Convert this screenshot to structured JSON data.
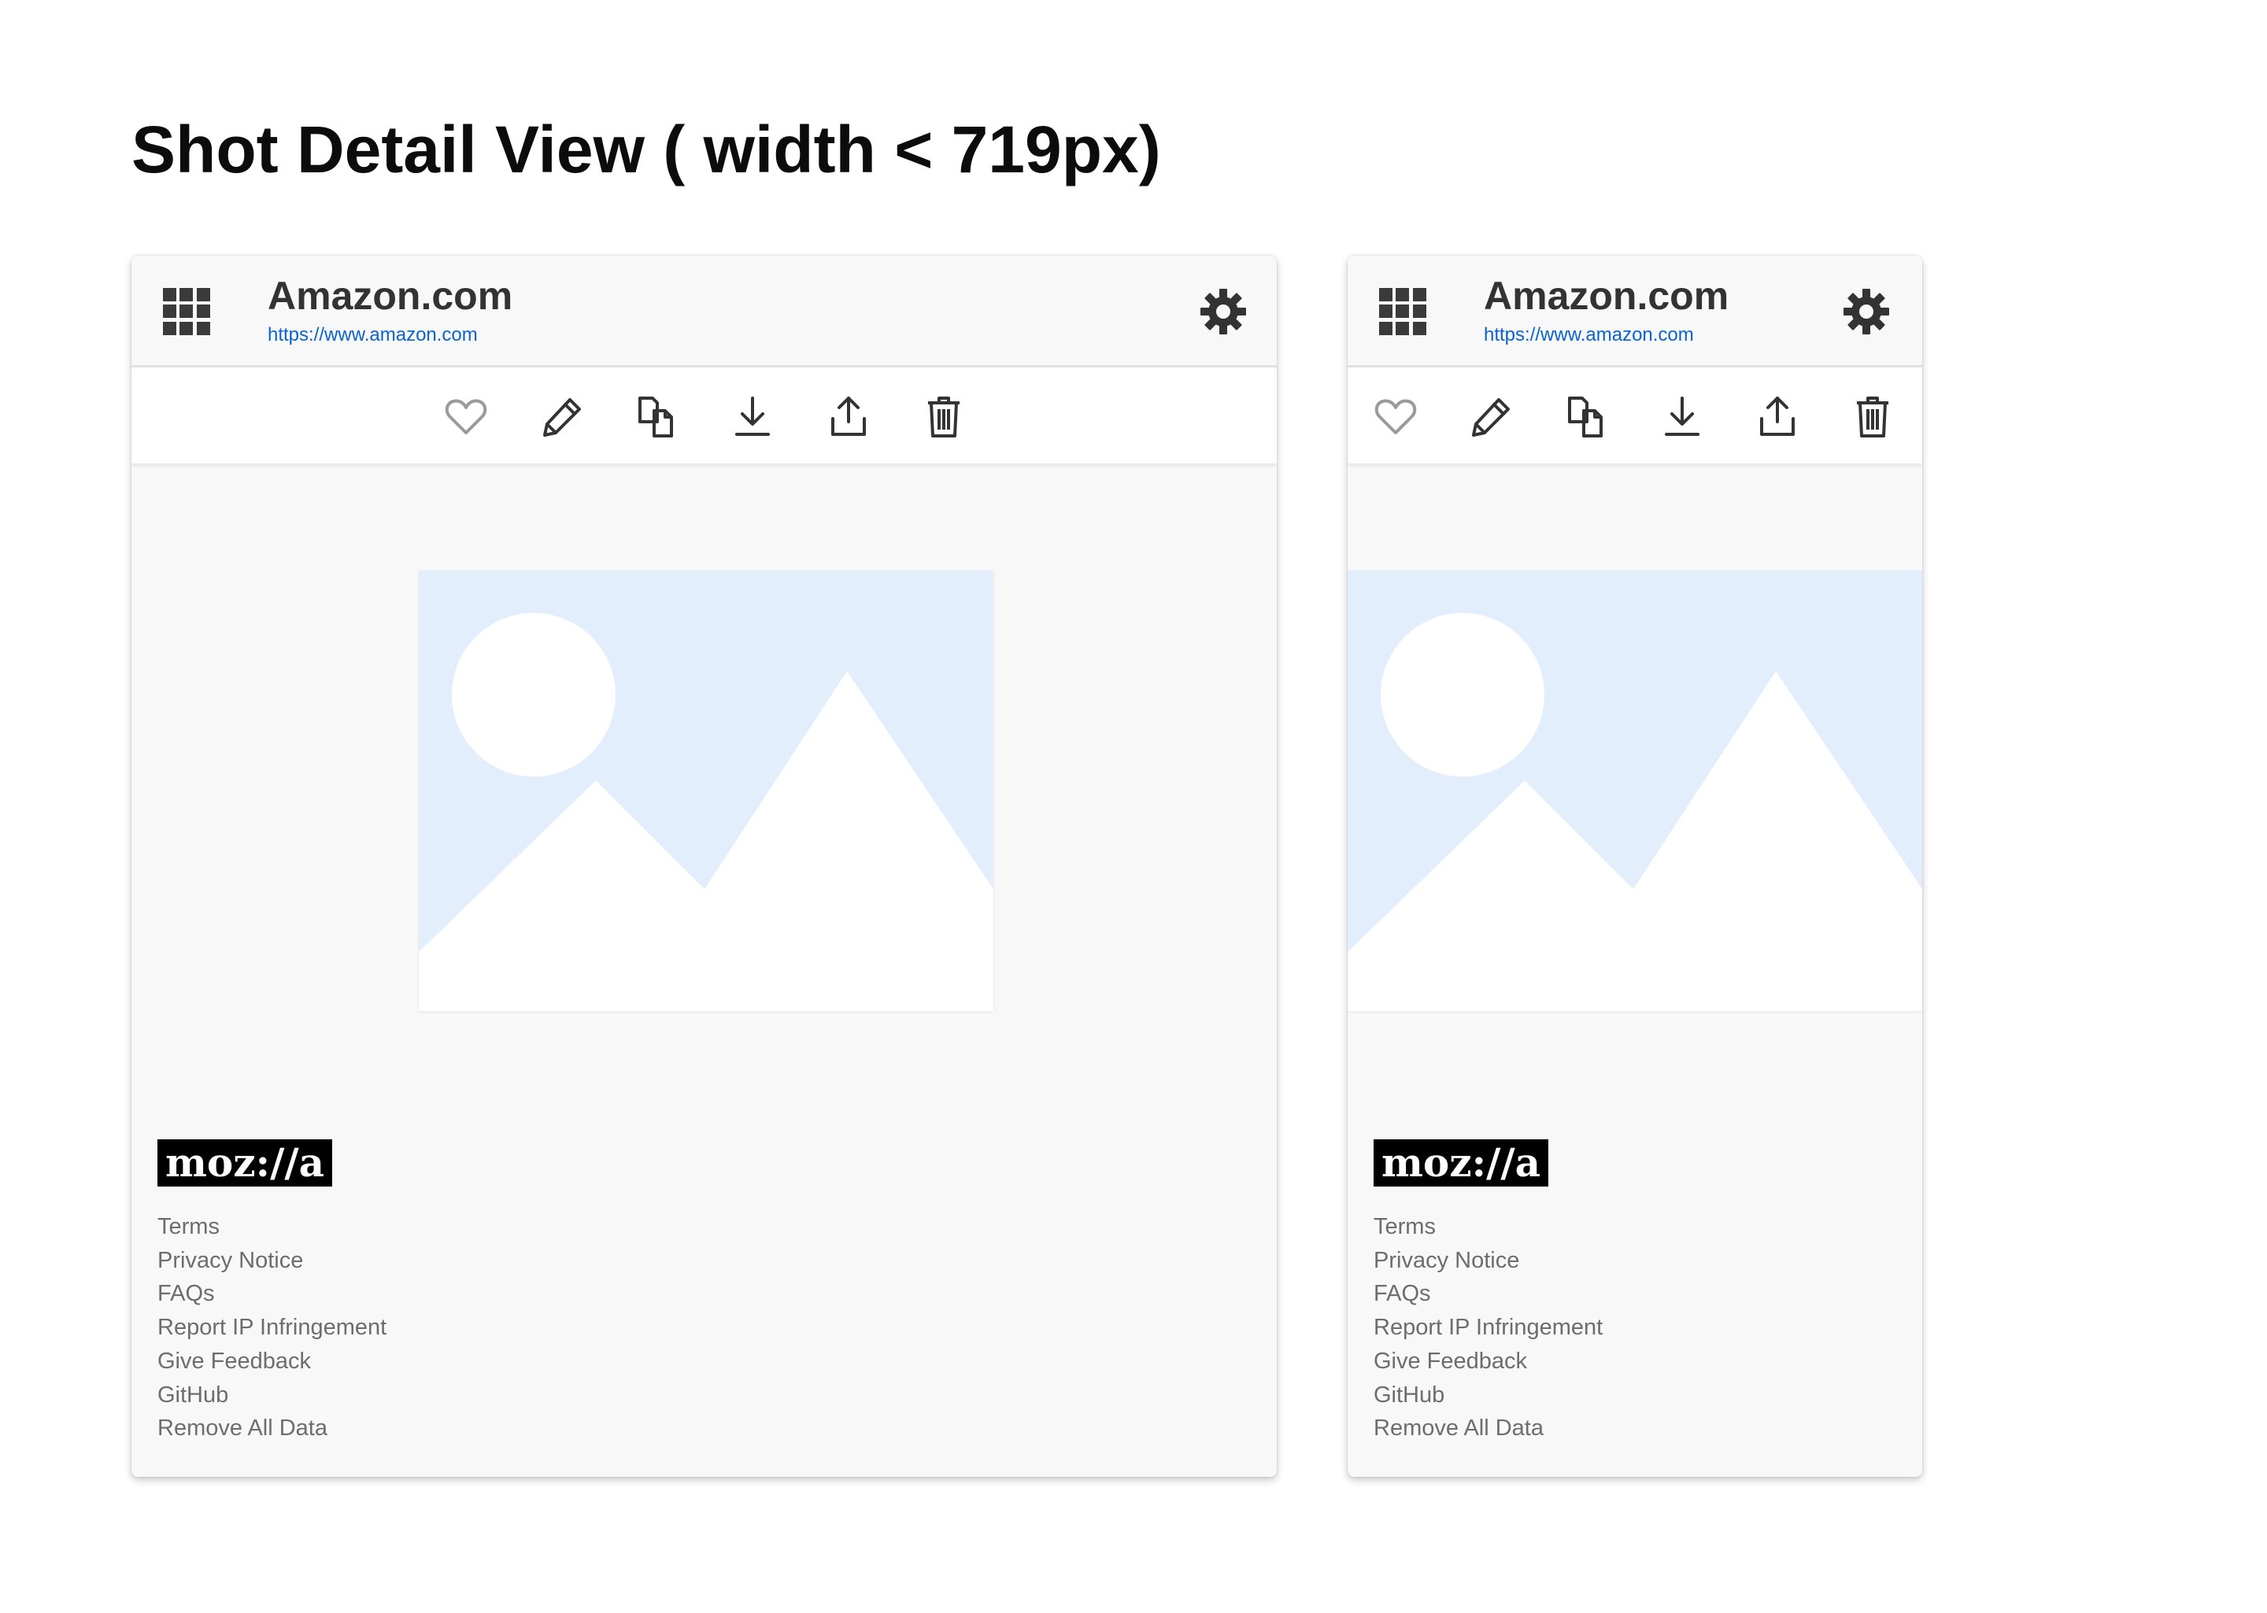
{
  "page": {
    "title": "Shot Detail View ( width < 719px)"
  },
  "panels": [
    {
      "header": {
        "site_title": "Amazon.com",
        "site_url": "https://www.amazon.com"
      },
      "toolbar": [
        "heart-icon",
        "pencil-icon",
        "copy-icon",
        "download-icon",
        "share-icon",
        "trash-icon"
      ],
      "footer": {
        "logo": "moz://a",
        "links": [
          "Terms",
          "Privacy Notice",
          "FAQs",
          "Report IP Infringement",
          "Give Feedback",
          "GitHub",
          "Remove All Data"
        ]
      }
    },
    {
      "header": {
        "site_title": "Amazon.com",
        "site_url": "https://www.amazon.com"
      },
      "toolbar": [
        "heart-icon",
        "pencil-icon",
        "copy-icon",
        "download-icon",
        "share-icon",
        "trash-icon"
      ],
      "footer": {
        "logo": "moz://a",
        "links": [
          "Terms",
          "Privacy Notice",
          "FAQs",
          "Report IP Infringement",
          "Give Feedback",
          "GitHub",
          "Remove All Data"
        ]
      }
    }
  ],
  "colors": {
    "link_blue": "#0a63d1",
    "icon_dark": "#333333",
    "heart_outline": "#9a9a9a",
    "placeholder_bg": "#e3eefc",
    "footer_text": "#6d6d6e",
    "panel_bg": "#f8f8f8"
  }
}
